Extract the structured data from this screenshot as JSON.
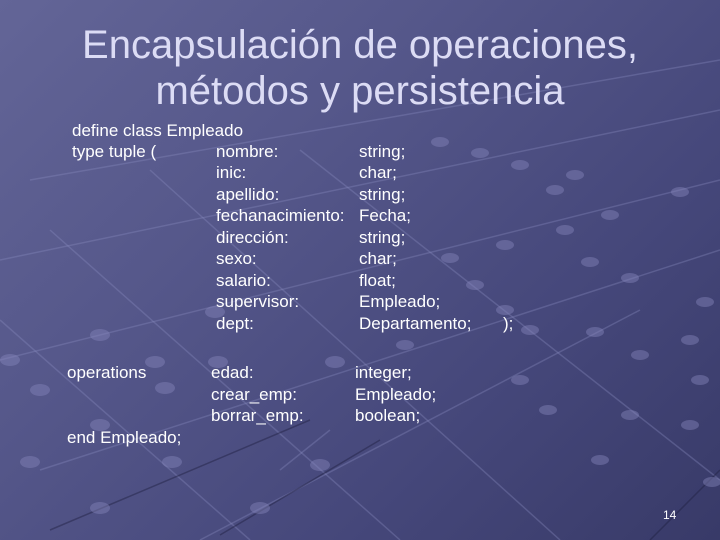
{
  "slide": {
    "title_line1": "Encapsulación de operaciones,",
    "title_line2": "métodos y persistencia",
    "page_number": "14",
    "colors": {
      "background": "#55578a",
      "title": "#dcdcf5",
      "body_text": "#ffffff"
    }
  },
  "code": {
    "define_line": "define class Empleado",
    "type_keyword": "type tuple (",
    "attributes": [
      {
        "name": "nombre:",
        "type": "string;"
      },
      {
        "name": "inic:",
        "type": "char;"
      },
      {
        "name": "apellido:",
        "type": "string;"
      },
      {
        "name": "fechanacimiento:",
        "type": "Fecha;"
      },
      {
        "name": "dirección:",
        "type": "string;"
      },
      {
        "name": "sexo:",
        "type": "char;"
      },
      {
        "name": "salario:",
        "type": "float;"
      },
      {
        "name": "supervisor:",
        "type": "Empleado;"
      },
      {
        "name": "dept:",
        "type": "Departamento;"
      }
    ],
    "tuple_close": ");",
    "operations_keyword": "operations",
    "operations": [
      {
        "name": "edad:",
        "type": "integer;"
      },
      {
        "name": "crear_emp:",
        "type": "Empleado;"
      },
      {
        "name": "borrar_emp:",
        "type": "boolean;"
      }
    ],
    "end_line": "end Empleado;"
  }
}
